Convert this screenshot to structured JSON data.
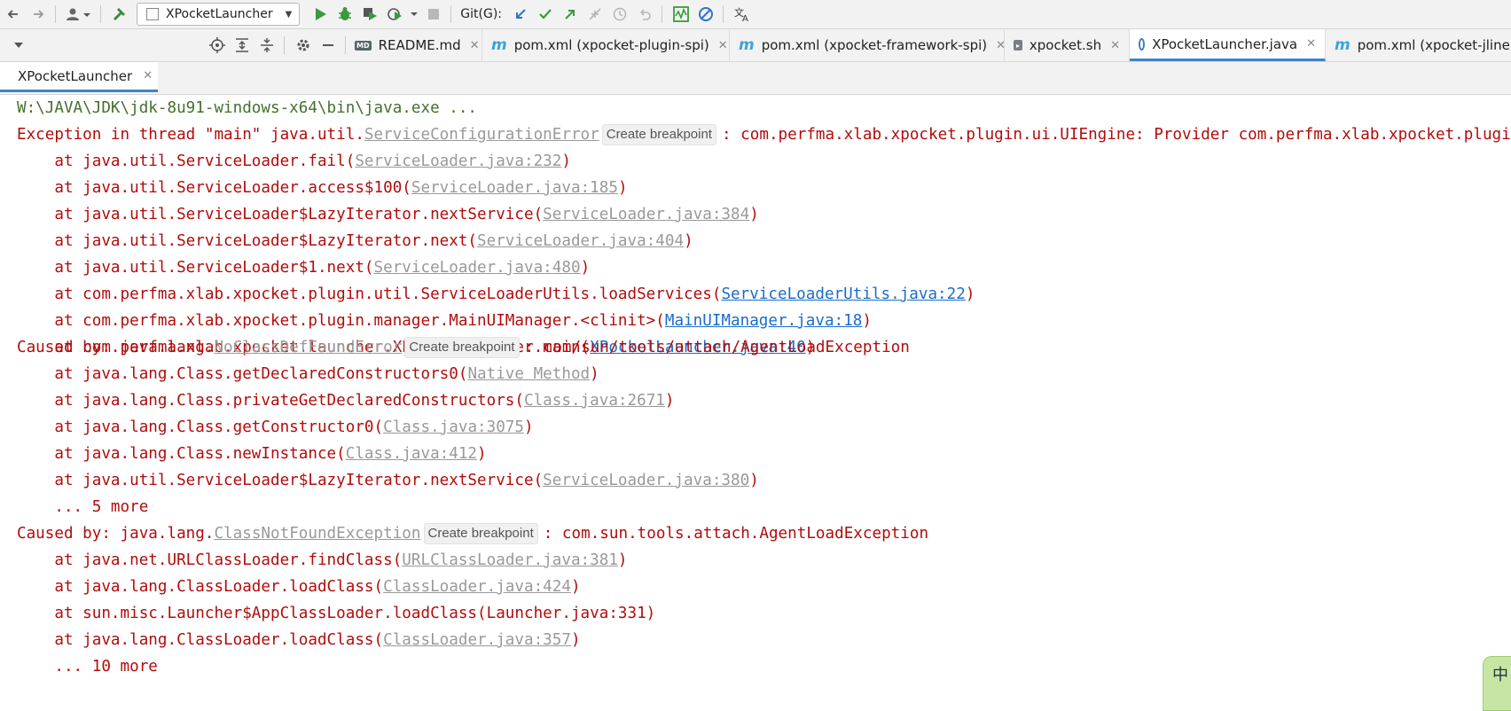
{
  "toolbar": {
    "run_config": "XPocketLauncher",
    "git_label": "Git(G):"
  },
  "tabs": [
    {
      "label": "README.md",
      "icon": "markdown-icon",
      "active": false
    },
    {
      "label": "pom.xml (xpocket-plugin-spi)",
      "icon": "maven-icon",
      "active": false
    },
    {
      "label": "pom.xml (xpocket-framework-spi)",
      "icon": "maven-icon",
      "active": false
    },
    {
      "label": "xpocket.sh",
      "icon": "shell-icon",
      "active": false
    },
    {
      "label": "XPocketLauncher.java",
      "icon": "java-class-icon",
      "active": true
    },
    {
      "label": "pom.xml (xpocket-jline",
      "icon": "maven-icon",
      "active": false
    }
  ],
  "run_tab": {
    "label": "XPocketLauncher"
  },
  "console": {
    "cmd": "W:\\JAVA\\JDK\\jdk-8u91-windows-x64\\bin\\java.exe ...",
    "exc1_prefix": "Exception in thread \"main\" java.util.",
    "exc1_link": "ServiceConfigurationError",
    "create_bp": "Create breakpoint",
    "exc1_suffix": ": com.perfma.xlab.xpocket.plugin.ui.UIEngine: Provider com.perfma.xlab.xpocket.plugin",
    "s1": [
      {
        "pre": "    at java.util.ServiceLoader.fail(",
        "link": "ServiceLoader.java:232",
        "post": ")",
        "style": "gray"
      },
      {
        "pre": "    at java.util.ServiceLoader.access$100(",
        "link": "ServiceLoader.java:185",
        "post": ")",
        "style": "gray"
      },
      {
        "pre": "    at java.util.ServiceLoader$LazyIterator.nextService(",
        "link": "ServiceLoader.java:384",
        "post": ")",
        "style": "gray"
      },
      {
        "pre": "    at java.util.ServiceLoader$LazyIterator.next(",
        "link": "ServiceLoader.java:404",
        "post": ")",
        "style": "gray"
      },
      {
        "pre": "    at java.util.ServiceLoader$1.next(",
        "link": "ServiceLoader.java:480",
        "post": ")",
        "style": "gray"
      },
      {
        "pre": "    at com.perfma.xlab.xpocket.plugin.util.ServiceLoaderUtils.loadServices(",
        "link": "ServiceLoaderUtils.java:22",
        "post": ")",
        "style": "blue"
      },
      {
        "pre": "    at com.perfma.xlab.xpocket.plugin.manager.MainUIManager.<clinit>(",
        "link": "MainUIManager.java:18",
        "post": ")",
        "style": "blue"
      },
      {
        "pre": "    at com.perfma.xlab.xpocket.launcher.XPocketLauncher.main(",
        "link": "XPocketLauncher.java:40",
        "post": ")",
        "style": "blue"
      }
    ],
    "cb1_prefix": "Caused by: java.lang.",
    "cb1_link": "NoClassDefFoundError",
    "cb1_suffix": ": com/sun/tools/attach/AgentLoadException",
    "s2": [
      {
        "pre": "    at java.lang.Class.getDeclaredConstructors0(",
        "link": "Native Method",
        "post": ")",
        "style": "gray"
      },
      {
        "pre": "    at java.lang.Class.privateGetDeclaredConstructors(",
        "link": "Class.java:2671",
        "post": ")",
        "style": "gray"
      },
      {
        "pre": "    at java.lang.Class.getConstructor0(",
        "link": "Class.java:3075",
        "post": ")",
        "style": "gray"
      },
      {
        "pre": "    at java.lang.Class.newInstance(",
        "link": "Class.java:412",
        "post": ")",
        "style": "gray"
      },
      {
        "pre": "    at java.util.ServiceLoader$LazyIterator.nextService(",
        "link": "ServiceLoader.java:380",
        "post": ")",
        "style": "gray"
      }
    ],
    "more1": "    ... 5 more",
    "cb2_prefix": "Caused by: java.lang.",
    "cb2_link": "ClassNotFoundException",
    "cb2_suffix": ": com.sun.tools.attach.AgentLoadException",
    "s3": [
      {
        "pre": "    at java.net.URLClassLoader.findClass(",
        "link": "URLClassLoader.java:381",
        "post": ")",
        "style": "gray"
      },
      {
        "pre": "    at java.lang.ClassLoader.loadClass(",
        "link": "ClassLoader.java:424",
        "post": ")",
        "style": "gray"
      }
    ],
    "s3_plain": "    at sun.misc.Launcher$AppClassLoader.loadClass(Launcher.java:331)",
    "s4": [
      {
        "pre": "    at java.lang.ClassLoader.loadClass(",
        "link": "ClassLoader.java:357",
        "post": ")",
        "style": "gray"
      }
    ],
    "more2": "    ... 10 more"
  },
  "ime": {
    "label": "中"
  }
}
